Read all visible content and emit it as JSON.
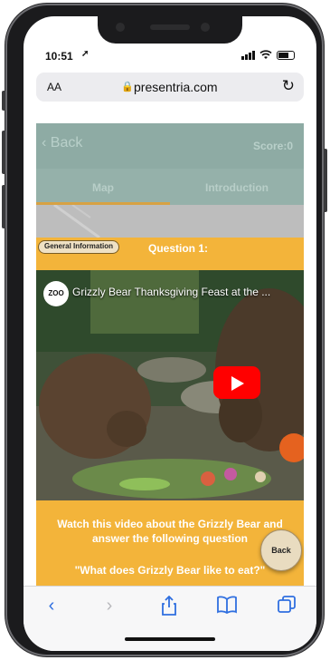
{
  "status_bar": {
    "time": "10:51"
  },
  "browser": {
    "text_size_label": "AA",
    "url": "presentria.com"
  },
  "app": {
    "back_label": "Back",
    "score_label": "Score:0",
    "tabs": [
      {
        "label": "Map",
        "active": true
      },
      {
        "label": "Introduction",
        "active": false
      }
    ],
    "badge_label": "General Information",
    "question_label": "Question 1:",
    "video": {
      "title": "Grizzly Bear Thanksgiving Feast at the ...",
      "channel_logo_text": "ZOO"
    },
    "instruction_text": "Watch this video about the Grizzly Bear and answer the following question",
    "question_text": "\"What does Grizzly Bear like to eat?\"",
    "floating_back_label": "Back"
  },
  "colors": {
    "header_teal": "#8eaba4",
    "accent_orange": "#f3b43a",
    "tab_underline": "#d7a244",
    "safari_blue": "#2f6fe0",
    "youtube_red": "#ff0000"
  }
}
